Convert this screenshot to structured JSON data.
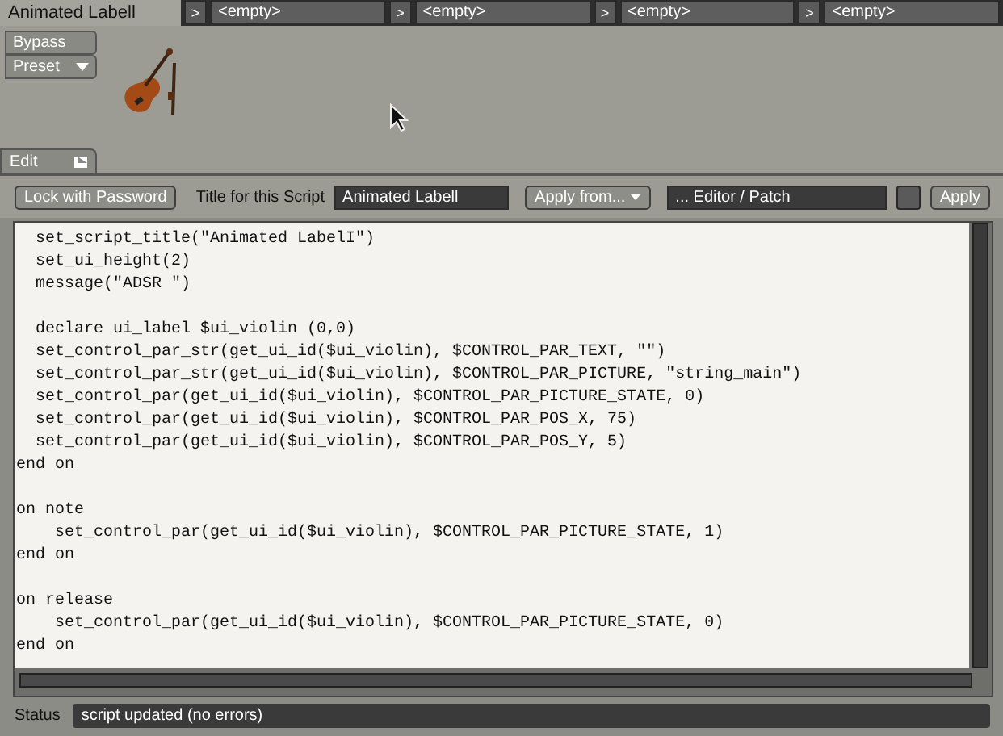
{
  "slots": [
    {
      "label": "Animated Labell",
      "selected": true
    },
    {
      "label": "<empty>",
      "selected": false,
      "expand": ">"
    },
    {
      "label": "<empty>",
      "selected": false,
      "expand": ">"
    },
    {
      "label": "<empty>",
      "selected": false,
      "expand": ">"
    },
    {
      "label": "<empty>",
      "selected": false,
      "expand": ">"
    }
  ],
  "side_buttons": [
    {
      "label": "Bypass",
      "kind": "plain"
    },
    {
      "label": "Preset",
      "kind": "dropdown"
    }
  ],
  "edit_tab": {
    "label": "Edit"
  },
  "toolbar": {
    "lock_button": "Lock with Password",
    "title_label": "Title for this Script",
    "title_value": "Animated Labell",
    "apply_from": "Apply from...",
    "source_field": "... Editor / Patch",
    "apply_button": "Apply"
  },
  "code_blocks": [
    [
      "  set_script_title(\"Animated LabelI\")",
      "  set_ui_height(2)",
      "  message(\"ADSR \")"
    ],
    [
      "  declare ui_label $ui_violin (0,0)",
      "  set_control_par_str(get_ui_id($ui_violin), $CONTROL_PAR_TEXT, \"\")",
      "  set_control_par_str(get_ui_id($ui_violin), $CONTROL_PAR_PICTURE, \"string_main\")",
      "  set_control_par(get_ui_id($ui_violin), $CONTROL_PAR_PICTURE_STATE, 0)",
      "  set_control_par(get_ui_id($ui_violin), $CONTROL_PAR_POS_X, 75)",
      "  set_control_par(get_ui_id($ui_violin), $CONTROL_PAR_POS_Y, 5)",
      "end on"
    ],
    [
      "on note",
      "    set_control_par(get_ui_id($ui_violin), $CONTROL_PAR_PICTURE_STATE, 1)",
      "end on"
    ],
    [
      "on release",
      "    set_control_par(get_ui_id($ui_violin), $CONTROL_PAR_PICTURE_STATE, 0)",
      "end on"
    ]
  ],
  "status": {
    "label": "Status",
    "value": "script updated (no errors)"
  }
}
